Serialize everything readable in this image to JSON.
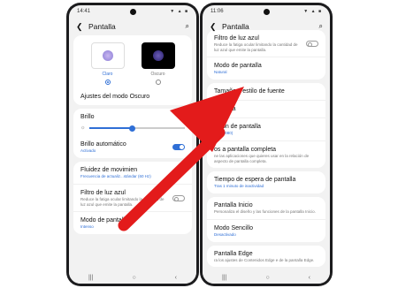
{
  "left": {
    "status_time": "14:41",
    "status_icons": "▼ ▲ ■",
    "title": "Pantalla",
    "themes": [
      {
        "label": "Claro",
        "selected": true
      },
      {
        "label": "Oscuro",
        "selected": false
      }
    ],
    "dark_settings": "Ajustes del modo Oscuro",
    "brightness": {
      "label": "Brillo",
      "level": 0.45
    },
    "adaptive": {
      "title": "Brillo automático",
      "sub": "Activado"
    },
    "fluidity": {
      "title": "Fluidez de movimien",
      "sub": "Frecuencia de actualiz...stándar (60 Hz)"
    },
    "blue_filter": {
      "title": "Filtro de luz azul",
      "desc": "Reduce la fatiga ocular limitando la cantidad de luz azul que emite la pantalla."
    },
    "screen_mode": {
      "title": "Modo de pantalla",
      "sub": "Intenso"
    }
  },
  "right": {
    "status_time": "11:06",
    "status_icons": "▼ ▲ ■",
    "title": "Pantalla",
    "blue_filter": {
      "title": "Filtro de luz azul",
      "desc": "Reduce la fatiga ocular limitando la cantidad de luz azul que emite la pantalla."
    },
    "screen_mode": {
      "title": "Modo de pantalla",
      "sub": "Natural"
    },
    "font": {
      "title": "Tamaño y estilo de fuente"
    },
    "zoom": {
      "title": "pantalla"
    },
    "resolution": {
      "title": "ución de pantalla",
      "sub": "00 x 1080)"
    },
    "fullscreen": {
      "title": "os a pantalla completa",
      "desc": "ne las aplicaciones que quieres usar en la relación de aspecto de pantalla completa."
    },
    "timeout": {
      "title": "Tiempo de espera de pantalla",
      "sub": "Tras 1 minuto de inactividad"
    },
    "home": {
      "title": "Pantalla Inicio",
      "desc": "Personaliza el diseño y las funciones de la pantalla Inicio."
    },
    "easy": {
      "title": "Modo Sencillo",
      "sub": "Desactivado"
    },
    "edge": {
      "title": "Pantalla Edge",
      "desc": "ra los ajustes de Contenidos Edge e de la pantalla Edge."
    }
  },
  "nav_icons": [
    "|||",
    "○",
    "‹"
  ],
  "colors": {
    "accent": "#2f6fd6",
    "arrow": "#e31b1b"
  }
}
